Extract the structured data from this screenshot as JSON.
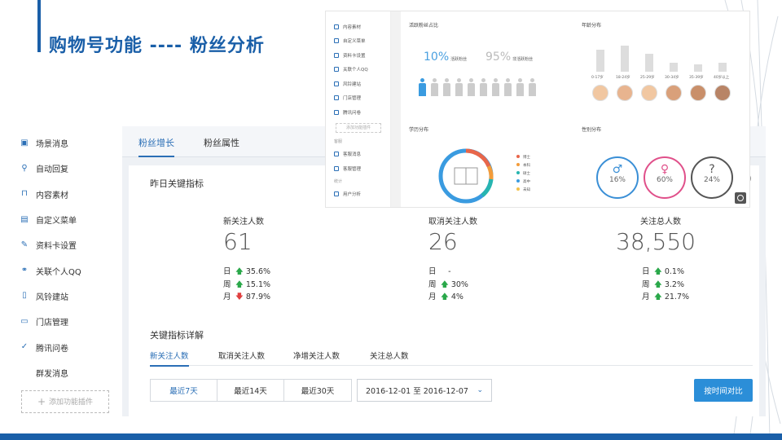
{
  "slide_title": "购物号功能 ----  粉丝分析",
  "colors": {
    "accent": "#1a5fa8",
    "link": "#2b6fb6",
    "up": "#2aa84a",
    "down": "#e04040",
    "button": "#2b8ed8"
  },
  "sidebar": {
    "items": [
      {
        "label": "场景消息",
        "icon": "message-icon"
      },
      {
        "label": "自动回复",
        "icon": "user-reply-icon"
      },
      {
        "label": "内容素材",
        "icon": "folder-icon"
      },
      {
        "label": "自定义菜单",
        "icon": "menu-icon"
      },
      {
        "label": "资料卡设置",
        "icon": "edit-card-icon"
      },
      {
        "label": "关联个人QQ",
        "icon": "link-icon"
      },
      {
        "label": "风铃建站",
        "icon": "phone-icon"
      },
      {
        "label": "门店管理",
        "icon": "store-icon"
      },
      {
        "label": "腾讯问卷",
        "icon": "checkmark-icon"
      },
      {
        "label": "群发消息",
        "icon": ""
      }
    ],
    "add_plugin": "添加功能插件"
  },
  "tabs": [
    "粉丝增长",
    "粉丝属性"
  ],
  "card": {
    "title": "昨日关键指标",
    "metrics": [
      {
        "label": "新关注人数",
        "value": "61",
        "rows": [
          {
            "k": "日",
            "dir": "up",
            "v": "35.6%"
          },
          {
            "k": "周",
            "dir": "up",
            "v": "15.1%"
          },
          {
            "k": "月",
            "dir": "down",
            "v": "87.9%"
          }
        ]
      },
      {
        "label": "取消关注人数",
        "value": "26",
        "rows": [
          {
            "k": "日",
            "dir": "none",
            "v": "-"
          },
          {
            "k": "周",
            "dir": "up",
            "v": "30%"
          },
          {
            "k": "月",
            "dir": "up",
            "v": "4%"
          }
        ]
      },
      {
        "label": "关注总人数",
        "value": "38,550",
        "rows": [
          {
            "k": "日",
            "dir": "up",
            "v": "0.1%"
          },
          {
            "k": "周",
            "dir": "up",
            "v": "3.2%"
          },
          {
            "k": "月",
            "dir": "up",
            "v": "21.7%"
          }
        ]
      }
    ],
    "detail_title": "关键指标详解",
    "subtabs": [
      "新关注人数",
      "取消关注人数",
      "净增关注人数",
      "关注总人数"
    ],
    "ranges": [
      "最近7天",
      "最近14天",
      "最近30天"
    ],
    "date_range": "2016-12-01 至 2016-12-07",
    "compare_button": "按时间对比"
  },
  "overlay": {
    "side_items": [
      "内容素材",
      "自定义菜单",
      "资料卡设置",
      "关联个人QQ",
      "风铃建站",
      "门店管理",
      "腾讯问卷"
    ],
    "add_plugin": "添加功能插件",
    "section1": "客服",
    "side_items2": [
      "客服消息",
      "客服管理"
    ],
    "section2": "统计",
    "side_items3": [
      "用户分析"
    ],
    "active_fans_title": "活跃粉丝占比",
    "active_pct": "10%",
    "active_label": "活跃粉丝",
    "inactive_pct": "95%",
    "inactive_label": "非活跃粉丝",
    "age_title": "年龄分布",
    "age_labels": [
      "0-17岁",
      "18-24岁",
      "25-29岁",
      "30-34岁",
      "35-39岁",
      "40岁以上"
    ],
    "age_values": [
      0.75,
      0.88,
      0.6,
      0.3,
      0.25,
      0.3
    ],
    "education_title": "学历分布",
    "education_legend": [
      {
        "label": "博士",
        "color": "#e8664a"
      },
      {
        "label": "本科",
        "color": "#f39c3a"
      },
      {
        "label": "硕士",
        "color": "#27b5b0"
      },
      {
        "label": "高中",
        "color": "#3a9be0"
      },
      {
        "label": "未知",
        "color": "#f2c14a"
      }
    ],
    "gender_title": "性别分布",
    "genders": [
      {
        "sym": "♂",
        "pct": "16%",
        "color": "#3a8fd6"
      },
      {
        "sym": "♀",
        "pct": "60%",
        "color": "#e0508a"
      },
      {
        "sym": "?",
        "pct": "24%",
        "color": "#555"
      }
    ]
  }
}
